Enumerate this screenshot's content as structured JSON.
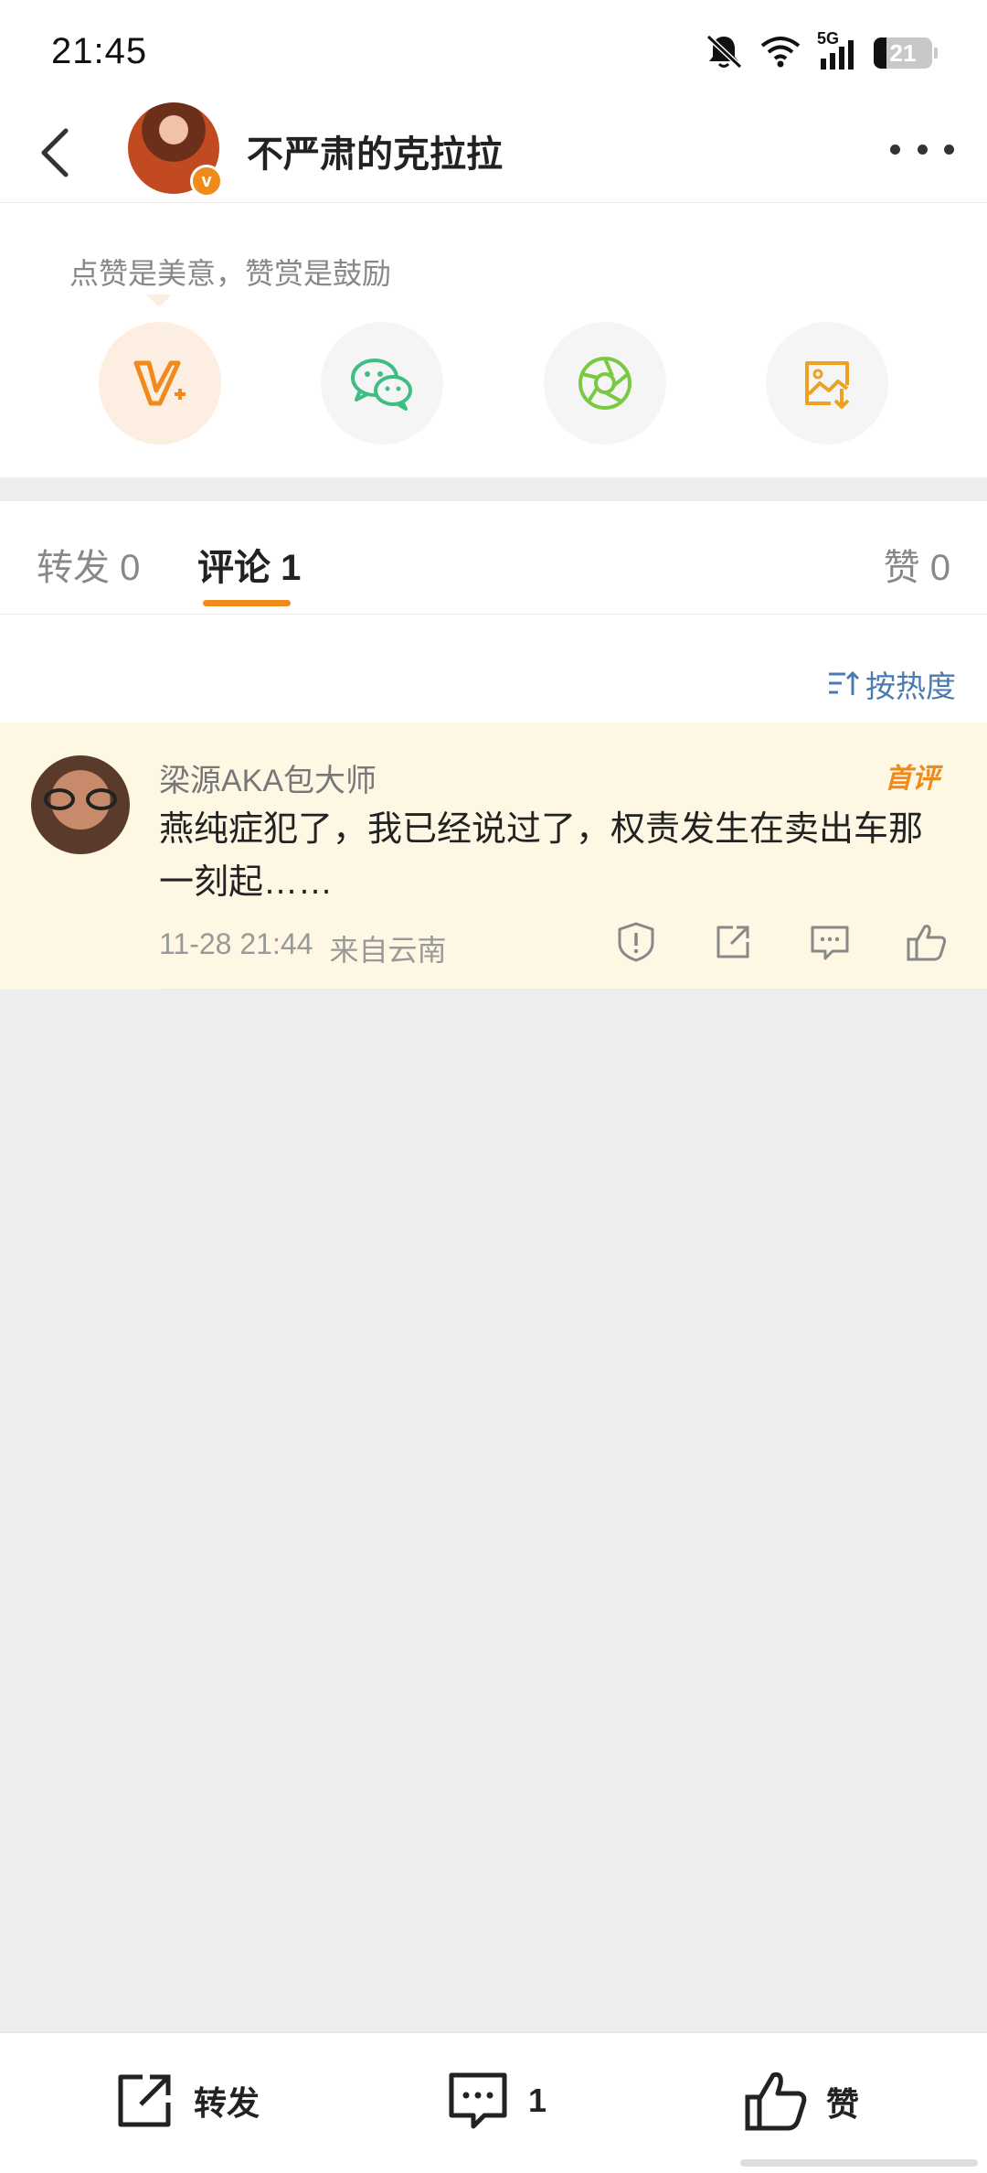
{
  "status_bar": {
    "time": "21:45",
    "network": "5G",
    "battery": "21",
    "icons": [
      "bell-off-icon",
      "wifi-icon",
      "signal-icon",
      "battery-icon"
    ]
  },
  "header": {
    "title": "不严肃的克拉拉",
    "verified_mark": "v"
  },
  "reward": {
    "hint": "点赞是美意，赞赏是鼓励",
    "options": [
      "v-plus-icon",
      "wechat-icon",
      "moments-icon",
      "save-image-icon"
    ]
  },
  "tabs": {
    "repost": "转发 0",
    "comment": "评论 1",
    "like": "赞 0"
  },
  "sort": {
    "label": "按热度"
  },
  "comments": [
    {
      "user": "梁源AKA包大师",
      "badge": "首评",
      "text": "燕纯症犯了，我已经说过了，权责发生在卖出车那一刻起……",
      "date": "11-28 21:44",
      "location": "来自云南"
    }
  ],
  "bottom_bar": {
    "repost_label": "转发",
    "comment_count": "1",
    "like_label": "赞"
  },
  "colors": {
    "accent": "#f08a1c",
    "link": "#4a7bb0",
    "comment_highlight": "#fdf7e4",
    "page_bg": "#ededed"
  }
}
